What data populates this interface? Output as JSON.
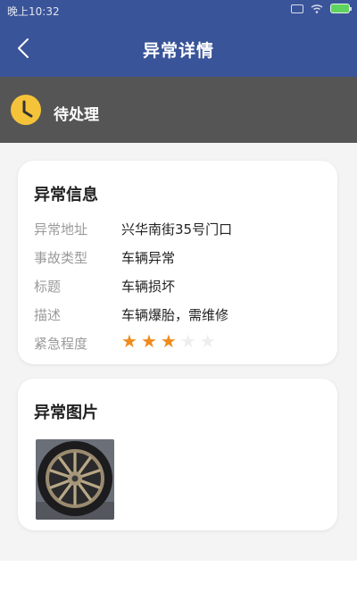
{
  "status_bar": {
    "time": "晚上10:32"
  },
  "header": {
    "title": "异常详情",
    "back_icon": "chevron-left-icon"
  },
  "status_strip": {
    "label": "待处理",
    "icon": "clock-icon"
  },
  "info_card": {
    "title": "异常信息",
    "rows": [
      {
        "key": "异常地址",
        "value": "兴华南街35号门口"
      },
      {
        "key": "事故类型",
        "value": "车辆异常"
      },
      {
        "key": "标题",
        "value": "车辆损坏"
      },
      {
        "key": "描述",
        "value": "车辆爆胎，需维修"
      }
    ],
    "urgency": {
      "key": "紧急程度",
      "rating": 3,
      "max": 5
    }
  },
  "image_card": {
    "title": "异常图片"
  },
  "colors": {
    "header": "#3a5499",
    "strip": "#555555",
    "star": "#f08a1c",
    "clock": "#f5c33a"
  }
}
